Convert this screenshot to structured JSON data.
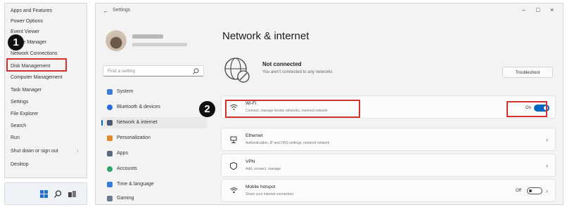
{
  "winx_menu": {
    "items": [
      "Apps and Features",
      "Power Options",
      "Event Viewer",
      "Device Manager",
      "Network Connections",
      "Disk Management",
      "Computer Management",
      "Task Manager",
      "Settings",
      "File Explorer",
      "Search",
      "Run",
      "Shut down or sign out",
      "Desktop"
    ]
  },
  "callouts": {
    "step1": "1",
    "step2": "2"
  },
  "window": {
    "title": "Settings",
    "back_icon": "back-arrow-icon",
    "controls": [
      "–",
      "□",
      "×"
    ]
  },
  "sidebar": {
    "search_placeholder": "Find a setting",
    "items": [
      {
        "label": "System",
        "color": "#3a7bd5"
      },
      {
        "label": "Bluetooth & devices",
        "color": "#2b6cd6"
      },
      {
        "label": "Network & internet",
        "color": "#4a5a70"
      },
      {
        "label": "Personalization",
        "color": "#e08a2c"
      },
      {
        "label": "Apps",
        "color": "#5a6a80"
      },
      {
        "label": "Accounts",
        "color": "#2fa36b"
      },
      {
        "label": "Time & language",
        "color": "#3a7bd5"
      },
      {
        "label": "Gaming",
        "color": "#6a7a90"
      }
    ]
  },
  "main": {
    "page_title": "Network & internet",
    "status": {
      "title": "Not connected",
      "subtitle": "You aren't connected to any networks",
      "troubleshoot_label": "Troubleshoot"
    },
    "cards": [
      {
        "icon": "wifi-icon",
        "glyph": "📶",
        "title": "Wi-Fi",
        "subtitle": "Connect, manage known networks, metered network",
        "control": "toggle-on",
        "toggle_label": "On"
      },
      {
        "icon": "ethernet-icon",
        "glyph": "🖧",
        "title": "Ethernet",
        "subtitle": "Authentication, IP and DNS settings, metered network",
        "control": "chevron"
      },
      {
        "icon": "vpn-icon",
        "glyph": "🛡",
        "title": "VPN",
        "subtitle": "Add, connect, manage",
        "control": "chevron"
      },
      {
        "icon": "mobile-hotspot-icon",
        "glyph": "📡",
        "title": "Mobile hotspot",
        "subtitle": "Share your internet connection",
        "control": "toggle-off",
        "toggle_label": "Off"
      }
    ]
  },
  "colors": {
    "accent": "#0067c0",
    "highlight": "#d0312d"
  }
}
